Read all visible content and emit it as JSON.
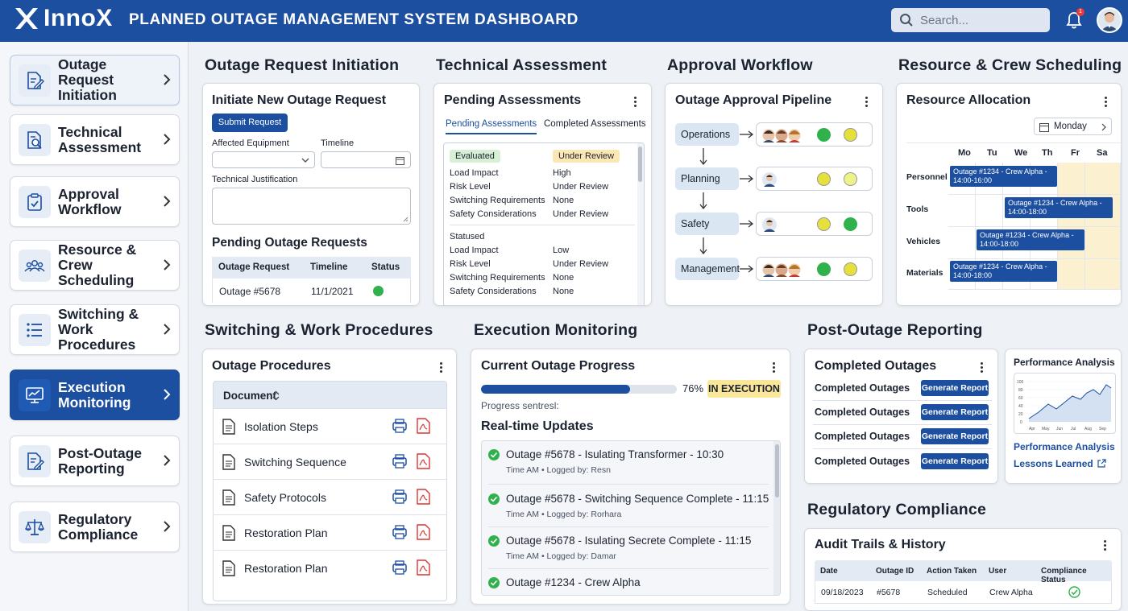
{
  "header": {
    "logo_text": "InnoX",
    "title": "PLANNED OUTAGE MANAGEMENT SYSTEM DASHBOARD",
    "search_placeholder": "Search...",
    "notification_count": "1"
  },
  "sidebar": {
    "items": [
      {
        "label": "Outage Request Initiation",
        "icon": "document-edit-icon"
      },
      {
        "label": "Technical Assessment",
        "icon": "document-search-icon"
      },
      {
        "label": "Approval Workflow",
        "icon": "clipboard-check-icon"
      },
      {
        "label": "Resource & Crew Scheduling",
        "icon": "crew-icon"
      },
      {
        "label": "Switching & Work Procedures",
        "icon": "list-icon"
      },
      {
        "label": "Execution Monitoring",
        "icon": "monitor-chart-icon"
      },
      {
        "label": "Post-Outage Reporting",
        "icon": "report-edit-icon"
      },
      {
        "label": "Regulatory Compliance",
        "icon": "scales-icon"
      }
    ],
    "active_index": 5
  },
  "sections": {
    "outage_request": "Outage Request Initiation",
    "technical": "Technical Assessment",
    "approval": "Approval Workflow",
    "resource": "Resource & Crew Scheduling",
    "switching": "Switching & Work Procedures",
    "execution": "Execution Monitoring",
    "post_outage": "Post-Outage Reporting",
    "regulatory": "Regulatory Compliance"
  },
  "outage_request": {
    "card_title": "Initiate New Outage Request",
    "submit_label": "Submit Request",
    "equipment_label": "Affected Equipment",
    "timeline_label": "Timeline",
    "justification_label": "Technical Justification",
    "pending_title": "Pending Outage Requests",
    "columns": [
      "Outage Request",
      "Timeline",
      "Status"
    ],
    "rows": [
      {
        "request": "Outage #5678",
        "timeline": "11/1/2021",
        "status": "green"
      }
    ]
  },
  "technical": {
    "card_title": "Pending Assessments",
    "tabs": [
      "Pending Assessments",
      "Completed Assessments"
    ],
    "block1": {
      "badge": "Evaluated",
      "status_badge": "Under Review",
      "rows": [
        {
          "k": "Load Impact",
          "v": "High"
        },
        {
          "k": "Risk Level",
          "v": "Under Review"
        },
        {
          "k": "Switching Requirements",
          "v": "None"
        },
        {
          "k": "Safety Considerations",
          "v": "Under Review"
        }
      ]
    },
    "block2": {
      "badge": "Statused",
      "rows": [
        {
          "k": "Load Impact",
          "v": "Low"
        },
        {
          "k": "Risk Level",
          "v": "Under Review"
        },
        {
          "k": "Switching Requirements",
          "v": "None"
        },
        {
          "k": "Safety Considerations",
          "v": "None"
        }
      ]
    }
  },
  "approval": {
    "card_title": "Outage Approval Pipeline",
    "stages": [
      "Operations",
      "Planning",
      "Safety",
      "Management"
    ]
  },
  "resource": {
    "card_title": "Resource Allocation",
    "day_select": "Monday",
    "days": [
      "Mo",
      "Tu",
      "We",
      "Th",
      "Fr",
      "Sa"
    ],
    "rows": [
      "Personnel",
      "Tools",
      "Vehicles",
      "Materials"
    ],
    "events": [
      {
        "line1": "Outage #1234 - Crew Alpha -",
        "line2": "14:00-16:00"
      },
      {
        "line1": "Outage #1234 - Crew Alpha -",
        "line2": "14:00-18:00"
      },
      {
        "line1": "Outage #1234 - Crew Alpha -",
        "line2": "14:00-18:00"
      },
      {
        "line1": "Outage #1234 - Crew Alpha -",
        "line2": "14:00-18:00"
      }
    ]
  },
  "switching": {
    "card_title": "Outage Procedures",
    "column": "Document",
    "docs": [
      "Isolation Steps",
      "Switching Sequence",
      "Safety Protocols",
      "Restoration Plan",
      "Restoration Plan"
    ]
  },
  "execution": {
    "card_title": "Current Outage Progress",
    "progress": 76,
    "progress_label": "76%",
    "status": "IN EXECUTION",
    "progress_sub": "Progress sentresl:",
    "updates_title": "Real-time Updates",
    "updates": [
      {
        "text": "Outage #5678 - Isulating Transformer - 10:30",
        "meta": "Time AM • Logged by: Resn"
      },
      {
        "text": "Outage #5678 - Switching Sequence Complete - 11:15",
        "meta": "Time AM • Logged by: Rorhara"
      },
      {
        "text": "Outage #5678 - Isulating Secrete Complete - 11:15",
        "meta": "Time AM • Logged by: Damar"
      },
      {
        "text": "Outage #1234 - Crew Alpha",
        "meta": ""
      }
    ]
  },
  "post_outage": {
    "card_title": "Completed Outages",
    "rows": [
      "Completed Outages",
      "Completed Outages",
      "Completed Outages",
      "Completed Outages"
    ],
    "button_label": "Generate Report",
    "perf_title": "Performance Analysis",
    "perf_link": "Performance Analysis",
    "lessons_link": "Lessons Learned",
    "perf_chart_x": [
      "Apr",
      "May",
      "Jun",
      "Jul",
      "Aug",
      "Sep"
    ],
    "perf_chart_y": [
      "100",
      "80",
      "60",
      "40",
      "20",
      "0"
    ]
  },
  "regulatory": {
    "card_title": "Audit Trails & History",
    "columns": [
      "Date",
      "Outage ID",
      "Action Taken",
      "User",
      "Compliance Status"
    ],
    "rows": [
      {
        "date": "09/18/2023",
        "id": "#5678",
        "action": "Scheduled",
        "user": "Crew Alpha",
        "status": "compliant"
      }
    ]
  }
}
